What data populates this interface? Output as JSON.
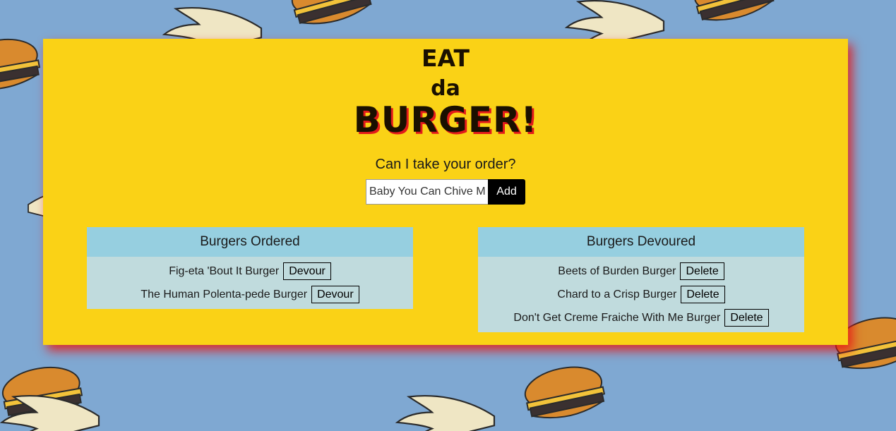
{
  "header": {
    "line1": "EAT",
    "line2": "da",
    "line3": "BURGER!"
  },
  "order_form": {
    "prompt": "Can I take your order?",
    "input_value": "Baby You Can Chive My Car Burger",
    "add_label": "Add"
  },
  "ordered": {
    "title": "Burgers Ordered",
    "button_label": "Devour",
    "items": [
      {
        "name": "Fig-eta 'Bout It Burger"
      },
      {
        "name": "The Human Polenta-pede Burger"
      }
    ]
  },
  "devoured": {
    "title": "Burgers Devoured",
    "button_label": "Delete",
    "items": [
      {
        "name": "Beets of Burden Burger"
      },
      {
        "name": "Chard to a Crisp Burger"
      },
      {
        "name": "Don't Get Creme Fraiche With Me Burger"
      }
    ]
  },
  "colors": {
    "background": "#7fa8d2",
    "card": "#fad216",
    "card_shadow": "#e61414",
    "panel_header": "#96cfe0",
    "panel_body": "#c0dbdd",
    "title_shadow": "#e21b1b"
  }
}
